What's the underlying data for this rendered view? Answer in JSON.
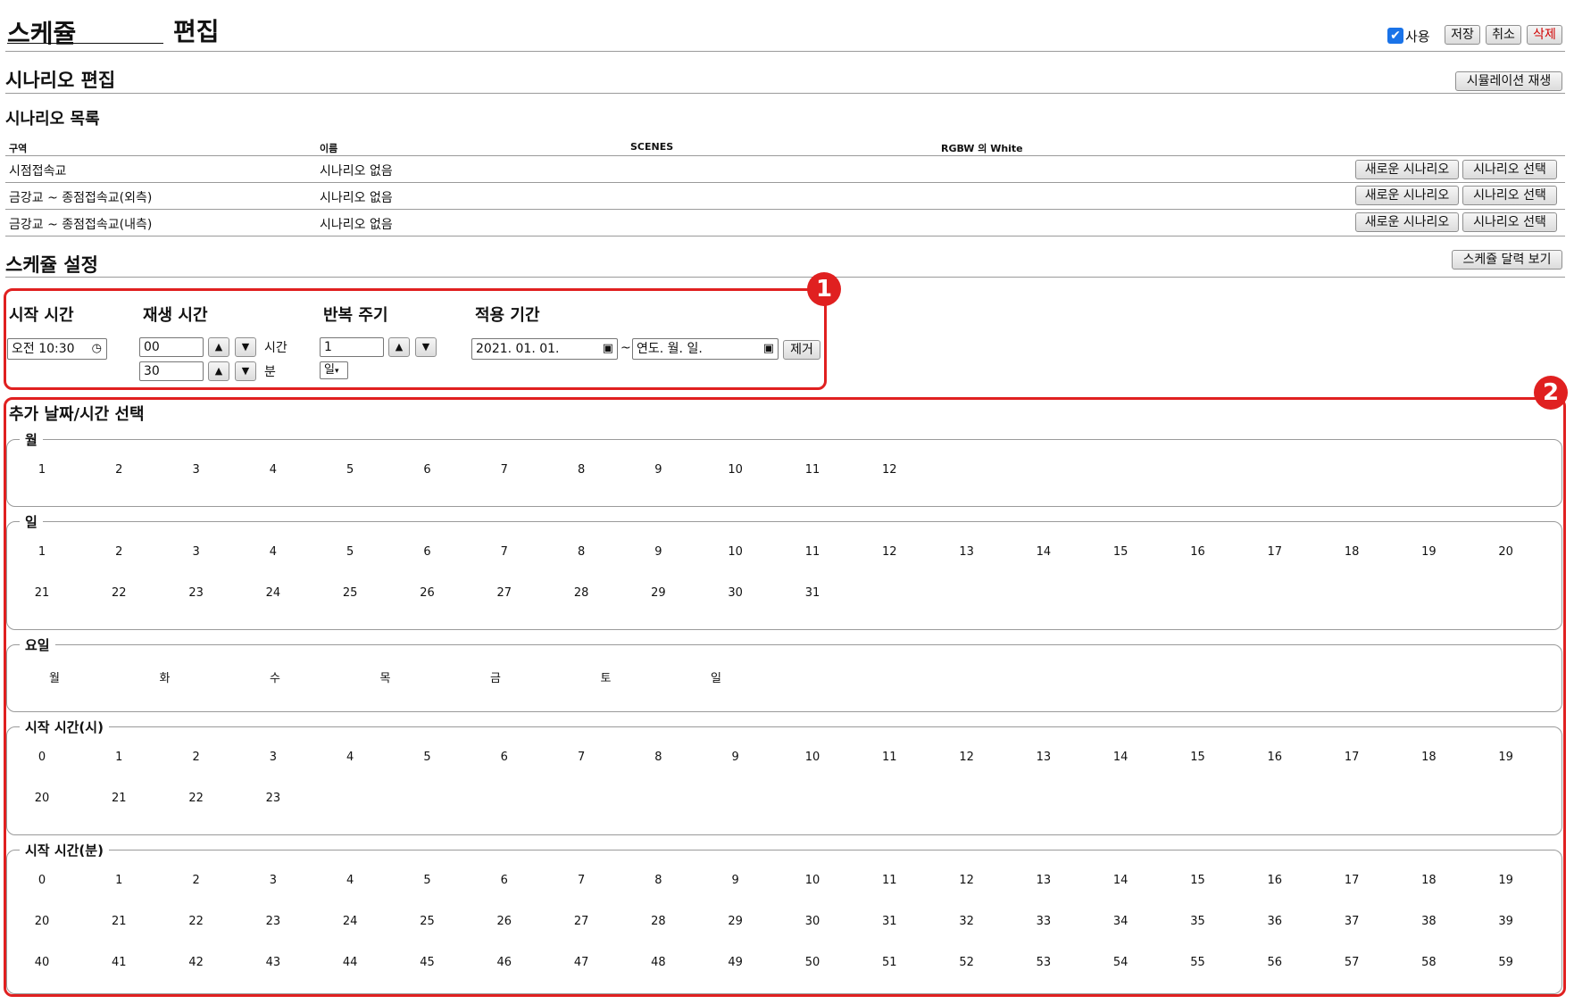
{
  "header": {
    "title_prefix": "스케쥴",
    "title_suffix": "편집",
    "use_label": "사용",
    "use_checked": true,
    "save_label": "저장",
    "cancel_label": "취소",
    "delete_label": "삭제"
  },
  "scenario_edit": {
    "title": "시나리오 편집",
    "simulate_label": "시뮬레이션 재생",
    "list_title": "시나리오 목록",
    "columns": [
      "구역",
      "이름",
      "SCENES",
      "RGBW 의 White"
    ],
    "rows": [
      {
        "zone": "시점접속교",
        "name": "시나리오 없음"
      },
      {
        "zone": "금강교 ~ 종점접속교(외측)",
        "name": "시나리오 없음"
      },
      {
        "zone": "금강교 ~ 종점접속교(내측)",
        "name": "시나리오 없음"
      }
    ],
    "new_btn": "새로운 시나리오",
    "select_btn": "시나리오 선택"
  },
  "schedule": {
    "title": "스케쥴 설정",
    "calendar_label": "스케쥴 달력 보기",
    "marker1": "1",
    "marker2": "2",
    "start_time_label": "시작 시간",
    "start_time_value": "오전 10:30",
    "play_time_label": "재생 시간",
    "hours_value": "00",
    "hours_unit": "시간",
    "minutes_value": "30",
    "minutes_unit": "분",
    "repeat_label": "반복 주기",
    "repeat_value": "1",
    "repeat_unit": "일",
    "period_label": "적용 기간",
    "period_start": "2021. 01. 01.",
    "period_sep": "~",
    "period_end": "연도. 월. 일.",
    "remove_label": "제거",
    "up_glyph": "▲",
    "down_glyph": "▼"
  },
  "extra": {
    "title": "추가 날짜/시간 선택",
    "month_legend": "월",
    "day_legend": "일",
    "weekday_legend": "요일",
    "hour_legend": "시작 시간(시)",
    "minute_legend": "시작 시간(분)",
    "months": [
      "1",
      "2",
      "3",
      "4",
      "5",
      "6",
      "7",
      "8",
      "9",
      "10",
      "11",
      "12"
    ],
    "days": [
      "1",
      "2",
      "3",
      "4",
      "5",
      "6",
      "7",
      "8",
      "9",
      "10",
      "11",
      "12",
      "13",
      "14",
      "15",
      "16",
      "17",
      "18",
      "19",
      "20",
      "21",
      "22",
      "23",
      "24",
      "25",
      "26",
      "27",
      "28",
      "29",
      "30",
      "31"
    ],
    "weekdays": [
      "월",
      "화",
      "수",
      "목",
      "금",
      "토",
      "일"
    ],
    "hours": [
      "0",
      "1",
      "2",
      "3",
      "4",
      "5",
      "6",
      "7",
      "8",
      "9",
      "10",
      "11",
      "12",
      "13",
      "14",
      "15",
      "16",
      "17",
      "18",
      "19",
      "20",
      "21",
      "22",
      "23"
    ],
    "minutes": [
      "0",
      "1",
      "2",
      "3",
      "4",
      "5",
      "6",
      "7",
      "8",
      "9",
      "10",
      "11",
      "12",
      "13",
      "14",
      "15",
      "16",
      "17",
      "18",
      "19",
      "20",
      "21",
      "22",
      "23",
      "24",
      "25",
      "26",
      "27",
      "28",
      "29",
      "30",
      "31",
      "32",
      "33",
      "34",
      "35",
      "36",
      "37",
      "38",
      "39",
      "40",
      "41",
      "42",
      "43",
      "44",
      "45",
      "46",
      "47",
      "48",
      "49",
      "50",
      "51",
      "52",
      "53",
      "54",
      "55",
      "56",
      "57",
      "58",
      "59"
    ]
  },
  "colors": {
    "accent_red": "#e02020",
    "delete_red": "#d00000",
    "checkbox_blue": "#1a73e8"
  }
}
